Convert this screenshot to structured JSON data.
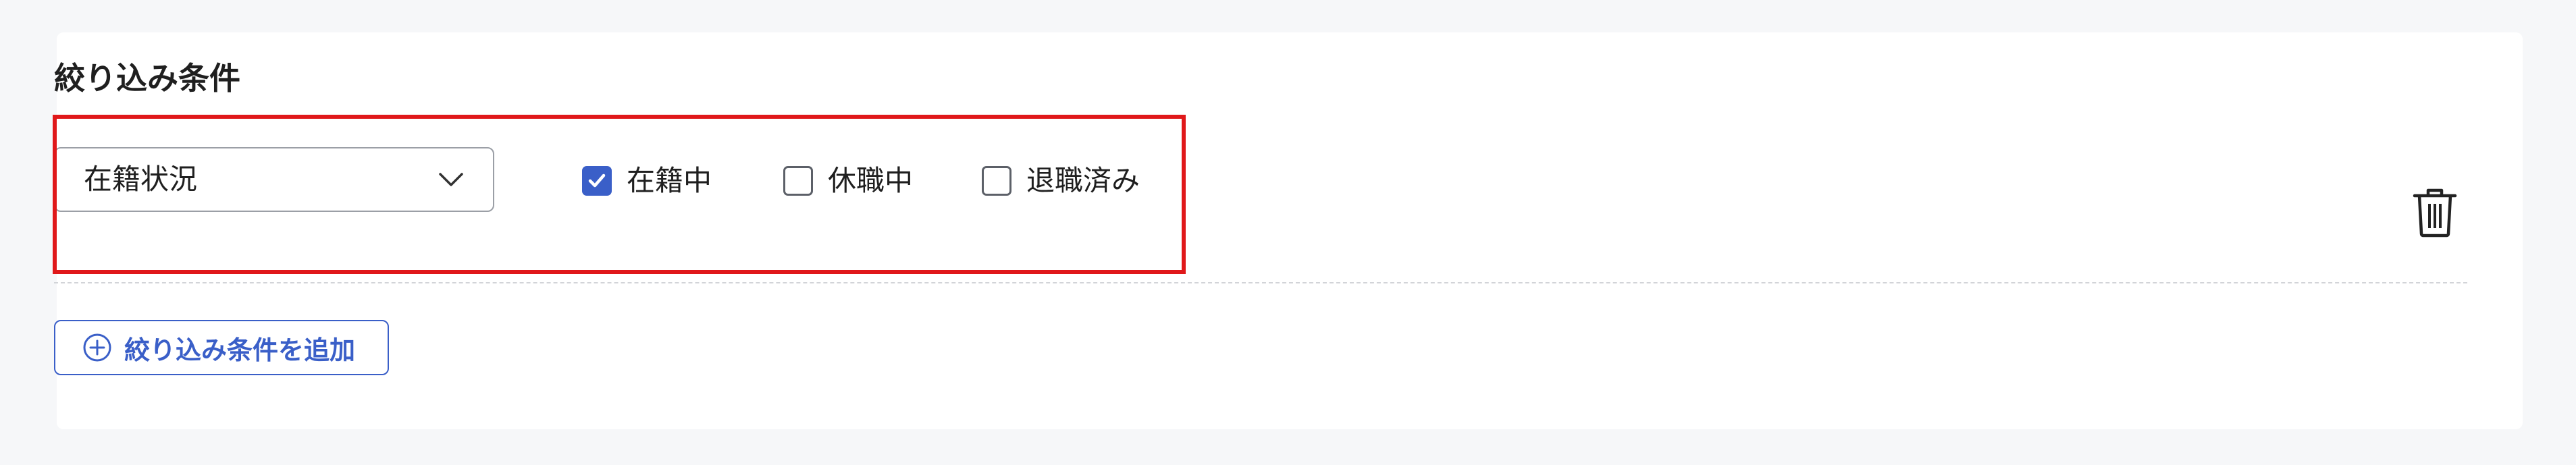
{
  "filters": {
    "title": "絞り込み条件",
    "condition": {
      "field_select": {
        "value": "在籍状況"
      },
      "options": [
        {
          "label": "在籍中",
          "checked": true
        },
        {
          "label": "休職中",
          "checked": false
        },
        {
          "label": "退職済み",
          "checked": false
        }
      ]
    },
    "add_button_label": "絞り込み条件を追加",
    "colors": {
      "accent": "#3a5fc8",
      "highlight": "#e0181a",
      "background": "#f6f7f9",
      "card": "#ffffff"
    },
    "icons": {
      "select": "chevron-down-icon",
      "delete": "trash-icon",
      "add": "plus-circle-icon",
      "checked": "checkmark-icon"
    }
  }
}
